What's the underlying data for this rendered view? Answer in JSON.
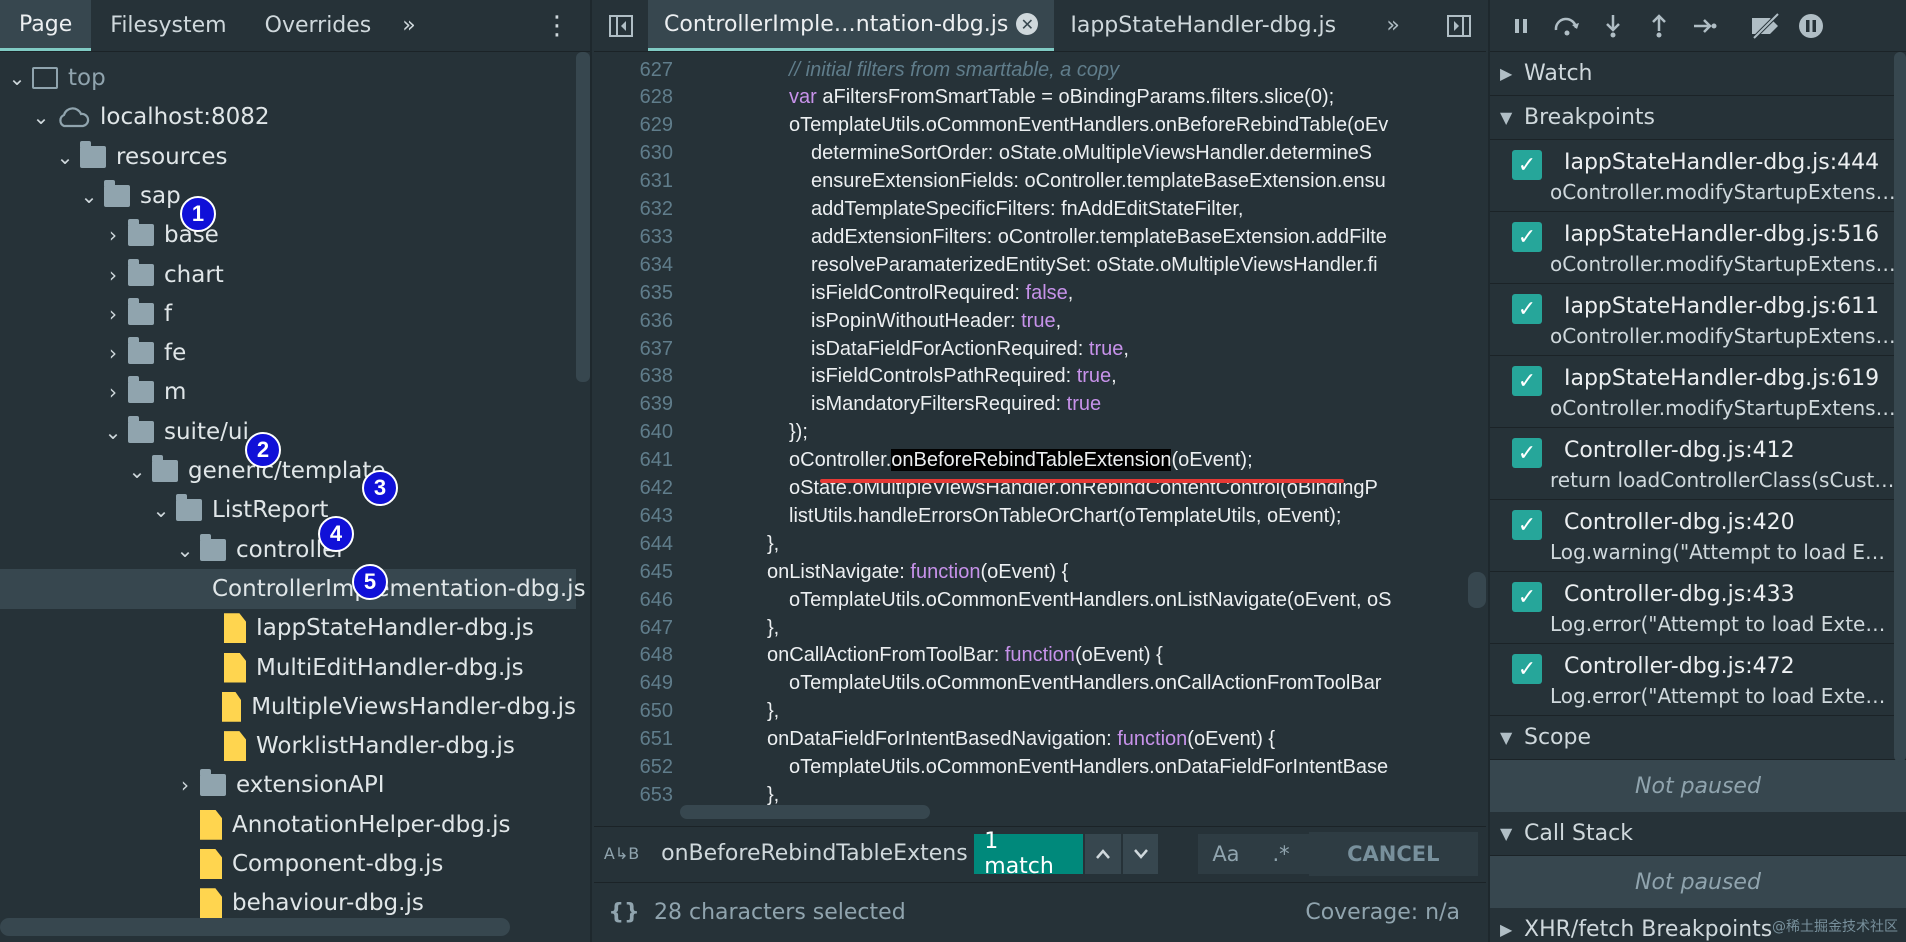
{
  "left_panel": {
    "tabs": [
      "Page",
      "Filesystem",
      "Overrides"
    ],
    "more_tabs_glyph": "»",
    "menu_glyph": "⋮",
    "tree": [
      {
        "label": "top",
        "depth": 0,
        "arrow": "open",
        "icon": "frame",
        "dim": true
      },
      {
        "label": "localhost:8082",
        "depth": 1,
        "arrow": "open",
        "icon": "cloud"
      },
      {
        "label": "resources",
        "depth": 2,
        "arrow": "open",
        "icon": "folder"
      },
      {
        "label": "sap",
        "depth": 3,
        "arrow": "open",
        "icon": "folder"
      },
      {
        "label": "base",
        "depth": 4,
        "arrow": "closed",
        "icon": "folder"
      },
      {
        "label": "chart",
        "depth": 4,
        "arrow": "closed",
        "icon": "folder"
      },
      {
        "label": "f",
        "depth": 4,
        "arrow": "closed",
        "icon": "folder"
      },
      {
        "label": "fe",
        "depth": 4,
        "arrow": "closed",
        "icon": "folder"
      },
      {
        "label": "m",
        "depth": 4,
        "arrow": "closed",
        "icon": "folder"
      },
      {
        "label": "suite/ui",
        "depth": 4,
        "arrow": "open",
        "icon": "folder"
      },
      {
        "label": "generic/template",
        "depth": 5,
        "arrow": "open",
        "icon": "folder"
      },
      {
        "label": "ListReport",
        "depth": 6,
        "arrow": "open",
        "icon": "folder"
      },
      {
        "label": "controller",
        "depth": 7,
        "arrow": "open",
        "icon": "folder"
      },
      {
        "label": "ControllerImplementation-dbg.js",
        "depth": 8,
        "arrow": "none",
        "icon": "file",
        "selected": true
      },
      {
        "label": "IappStateHandler-dbg.js",
        "depth": 8,
        "arrow": "none",
        "icon": "file"
      },
      {
        "label": "MultiEditHandler-dbg.js",
        "depth": 8,
        "arrow": "none",
        "icon": "file"
      },
      {
        "label": "MultipleViewsHandler-dbg.js",
        "depth": 8,
        "arrow": "none",
        "icon": "file"
      },
      {
        "label": "WorklistHandler-dbg.js",
        "depth": 8,
        "arrow": "none",
        "icon": "file"
      },
      {
        "label": "extensionAPI",
        "depth": 7,
        "arrow": "closed",
        "icon": "folder"
      },
      {
        "label": "AnnotationHelper-dbg.js",
        "depth": 7,
        "arrow": "none",
        "icon": "file"
      },
      {
        "label": "Component-dbg.js",
        "depth": 7,
        "arrow": "none",
        "icon": "file"
      },
      {
        "label": "behaviour-dbg.js",
        "depth": 7,
        "arrow": "none",
        "icon": "file"
      }
    ],
    "badges": [
      "1",
      "2",
      "3",
      "4",
      "5"
    ]
  },
  "editor": {
    "tabs": [
      {
        "label": "ControllerImple…ntation-dbg.js",
        "active": true,
        "closable": true
      },
      {
        "label": "IappStateHandler-dbg.js",
        "active": false
      }
    ],
    "more_tabs_glyph": "»",
    "lines": [
      {
        "n": "627",
        "indent": 5,
        "parts": [
          {
            "t": "// initial filters from smarttable, a copy",
            "c": "cm"
          }
        ]
      },
      {
        "n": "628",
        "indent": 5,
        "parts": [
          {
            "t": "var",
            "c": "kw"
          },
          {
            "t": " aFiltersFromSmartTable = oBindingParams.filters.slice(0);"
          }
        ]
      },
      {
        "n": "629",
        "indent": 5,
        "parts": [
          {
            "t": "oTemplateUtils.oCommonEventHandlers.onBeforeRebindTable(oEv"
          }
        ]
      },
      {
        "n": "630",
        "indent": 6,
        "parts": [
          {
            "t": "determineSortOrder: oState.oMultipleViewsHandler.determineS"
          }
        ]
      },
      {
        "n": "631",
        "indent": 6,
        "parts": [
          {
            "t": "ensureExtensionFields: oController.templateBaseExtension.ensu"
          }
        ]
      },
      {
        "n": "632",
        "indent": 6,
        "parts": [
          {
            "t": "addTemplateSpecificFilters: fnAddEditStateFilter,"
          }
        ]
      },
      {
        "n": "633",
        "indent": 6,
        "parts": [
          {
            "t": "addExtensionFilters: oController.templateBaseExtension.addFilte"
          }
        ]
      },
      {
        "n": "634",
        "indent": 6,
        "parts": [
          {
            "t": "resolveParamaterizedEntitySet: oState.oMultipleViewsHandler.fi"
          }
        ]
      },
      {
        "n": "635",
        "indent": 6,
        "parts": [
          {
            "t": "isFieldControlRequired: "
          },
          {
            "t": "false",
            "c": "kw"
          },
          {
            "t": ","
          }
        ]
      },
      {
        "n": "636",
        "indent": 6,
        "parts": [
          {
            "t": "isPopinWithoutHeader: "
          },
          {
            "t": "true",
            "c": "kw"
          },
          {
            "t": ","
          }
        ]
      },
      {
        "n": "637",
        "indent": 6,
        "parts": [
          {
            "t": "isDataFieldForActionRequired: "
          },
          {
            "t": "true",
            "c": "kw"
          },
          {
            "t": ","
          }
        ]
      },
      {
        "n": "638",
        "indent": 6,
        "parts": [
          {
            "t": "isFieldControlsPathRequired: "
          },
          {
            "t": "true",
            "c": "kw"
          },
          {
            "t": ","
          }
        ]
      },
      {
        "n": "639",
        "indent": 6,
        "parts": [
          {
            "t": "isMandatoryFiltersRequired: "
          },
          {
            "t": "true",
            "c": "kw"
          }
        ]
      },
      {
        "n": "640",
        "indent": 5,
        "parts": [
          {
            "t": "});"
          }
        ]
      },
      {
        "n": "641",
        "indent": 5,
        "parts": [
          {
            "t": "oController."
          },
          {
            "t": "onBeforeRebindTableExtension",
            "c": "hl-word"
          },
          {
            "t": "(oEvent);"
          }
        ]
      },
      {
        "n": "642",
        "indent": 5,
        "parts": [
          {
            "t": "oState.oMultipleViewsHandler.onRebindContentControl(oBindingP"
          }
        ]
      },
      {
        "n": "643",
        "indent": 5,
        "parts": [
          {
            "t": "listUtils.handleErrorsOnTableOrChart(oTemplateUtils, oEvent);"
          }
        ]
      },
      {
        "n": "644",
        "indent": 4,
        "parts": [
          {
            "t": "},"
          }
        ]
      },
      {
        "n": "645",
        "indent": 4,
        "parts": [
          {
            "t": "onListNavigate: "
          },
          {
            "t": "function",
            "c": "kw"
          },
          {
            "t": "(oEvent) {"
          }
        ]
      },
      {
        "n": "646",
        "indent": 5,
        "parts": [
          {
            "t": "oTemplateUtils.oCommonEventHandlers.onListNavigate(oEvent, oS"
          }
        ]
      },
      {
        "n": "647",
        "indent": 4,
        "parts": [
          {
            "t": "},"
          }
        ]
      },
      {
        "n": "648",
        "indent": 4,
        "parts": [
          {
            "t": "onCallActionFromToolBar: "
          },
          {
            "t": "function",
            "c": "kw"
          },
          {
            "t": "(oEvent) {"
          }
        ]
      },
      {
        "n": "649",
        "indent": 5,
        "parts": [
          {
            "t": "oTemplateUtils.oCommonEventHandlers.onCallActionFromToolBar"
          }
        ]
      },
      {
        "n": "650",
        "indent": 4,
        "parts": [
          {
            "t": "},"
          }
        ]
      },
      {
        "n": "651",
        "indent": 4,
        "parts": [
          {
            "t": "onDataFieldForIntentBasedNavigation: "
          },
          {
            "t": "function",
            "c": "kw"
          },
          {
            "t": "(oEvent) {"
          }
        ]
      },
      {
        "n": "652",
        "indent": 5,
        "parts": [
          {
            "t": "oTemplateUtils.oCommonEventHandlers.onDataFieldForIntentBase"
          }
        ]
      },
      {
        "n": "653",
        "indent": 4,
        "parts": [
          {
            "t": "},"
          }
        ]
      }
    ],
    "search": {
      "icon_glyph": "A↳B",
      "value": "onBeforeRebindTableExtens",
      "match_label": "1 match",
      "up_glyph": "⌃",
      "down_glyph": "⌄",
      "case_label": "Aa",
      "regex_label": ".*",
      "cancel_label": "CANCEL"
    },
    "status": {
      "braces_glyph": "{}",
      "selection": "28 characters selected",
      "coverage": "Coverage: n/a"
    }
  },
  "right_panel": {
    "toolbar_glyphs": [
      "❚❚",
      "↷",
      "↓",
      "↑",
      "→•",
      "⟋",
      "⏸"
    ],
    "sections": {
      "watch": "Watch",
      "breakpoints": "Breakpoints",
      "scope": "Scope",
      "call_stack": "Call Stack",
      "xhr": "XHR/fetch Breakpoints"
    },
    "breakpoints": [
      {
        "name": "IappStateHandler-dbg.js:444",
        "code": "oController.modifyStartupExtension"
      },
      {
        "name": "IappStateHandler-dbg.js:516",
        "code": "oController.modifyStartupExtension"
      },
      {
        "name": "IappStateHandler-dbg.js:611",
        "code": "oController.modifyStartupExtension"
      },
      {
        "name": "IappStateHandler-dbg.js:619",
        "code": "oController.modifyStartupExtension"
      },
      {
        "name": "Controller-dbg.js:412",
        "code": "return loadControllerClass(sCustom"
      },
      {
        "name": "Controller-dbg.js:420",
        "code": "Log.warning(\"Attempt to load Extension"
      },
      {
        "name": "Controller-dbg.js:433",
        "code": "Log.error(\"Attempt to load Extension"
      },
      {
        "name": "Controller-dbg.js:472",
        "code": "Log.error(\"Attempt to load Extension"
      }
    ],
    "not_paused": "Not paused",
    "check_glyph": "✓"
  },
  "watermark": "@稀土掘金技术社区"
}
